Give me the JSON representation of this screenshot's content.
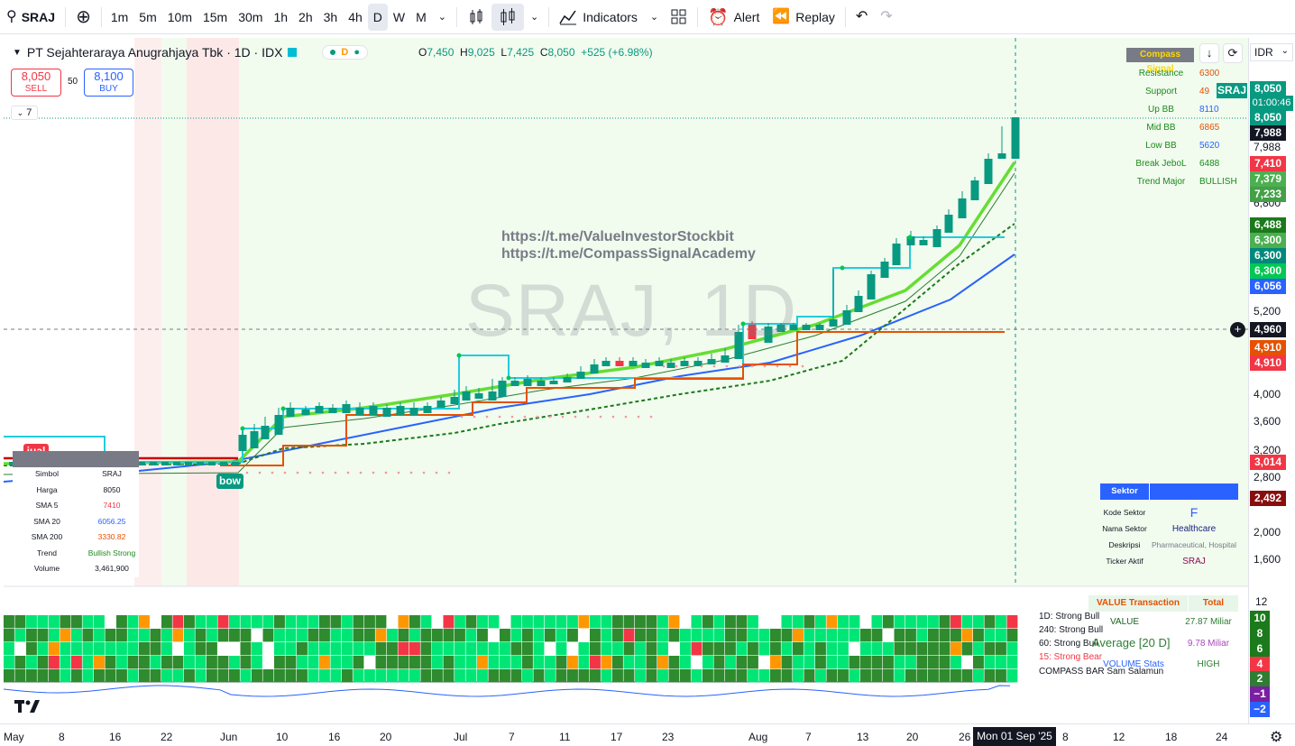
{
  "toolbar": {
    "symbol": "SRAJ",
    "intervals": [
      "1m",
      "5m",
      "10m",
      "15m",
      "30m",
      "1h",
      "2h",
      "3h",
      "4h",
      "D",
      "W",
      "M"
    ],
    "active_interval": "D",
    "indicators_label": "Indicators",
    "alert_label": "Alert",
    "replay_label": "Replay"
  },
  "legend": {
    "title": "PT Sejahteraraya Anugrahjaya Tbk · 1D · IDX",
    "badge": "D",
    "o_label": "O",
    "o": "7,450",
    "h_label": "H",
    "h": "9,025",
    "l_label": "L",
    "l": "7,425",
    "c_label": "C",
    "c": "8,050",
    "change": "+525 (+6.98%)",
    "sell_price": "8,050",
    "sell_label": "SELL",
    "buy_price": "8,100",
    "buy_label": "BUY",
    "spread": "50",
    "collapse_count": "7"
  },
  "watermark": "SRAJ, 1D",
  "links": [
    "https://t.me/ValueInvestorStockbit",
    "https://t.me/CompassSignalAcademy"
  ],
  "compass_signal": {
    "header": "Compass Signal",
    "rows": [
      {
        "label": "Resistance",
        "value": "6300",
        "color": "#e65100"
      },
      {
        "label": "Support",
        "value": "49",
        "color": "#e65100"
      },
      {
        "label": "Up BB",
        "value": "8110",
        "color": "#2962ff"
      },
      {
        "label": "Mid BB",
        "value": "6865",
        "color": "#e65100"
      },
      {
        "label": "Low BB",
        "value": "5620",
        "color": "#2962ff"
      },
      {
        "label": "Break JeboL",
        "value": "6488",
        "color": "#1b8a1b"
      },
      {
        "label": "Trend Major",
        "value": "BULLISH",
        "color": "#1b8a1b"
      }
    ]
  },
  "scale": {
    "currency": "IDR",
    "ticks": [
      "7,988",
      "6,800",
      "5,200",
      "4,000",
      "3,600",
      "3,200",
      "2,800",
      "2,000",
      "1,600"
    ],
    "badges": [
      {
        "text": "SRAJ",
        "color": "#089981"
      },
      {
        "text": "8,050",
        "color": "#089981"
      },
      {
        "text": "01:00:46",
        "color": "#089981"
      },
      {
        "text": "8,050",
        "color": "#089981"
      },
      {
        "text": "7,988",
        "color": "#131722"
      },
      {
        "text": "7,410",
        "color": "#f23645"
      },
      {
        "text": "7,379",
        "color": "#4caf50"
      },
      {
        "text": "7,233",
        "color": "#43a047"
      },
      {
        "text": "6,488",
        "color": "#1b7a1b"
      },
      {
        "text": "6,300",
        "color": "#4caf50"
      },
      {
        "text": "6,300",
        "color": "#00897b"
      },
      {
        "text": "6,300",
        "color": "#00c853"
      },
      {
        "text": "6,056",
        "color": "#2962ff"
      },
      {
        "text": "4,960",
        "color": "#131722"
      },
      {
        "text": "4,910",
        "color": "#e65100"
      },
      {
        "text": "4,910",
        "color": "#f23645"
      },
      {
        "text": "3,014",
        "color": "#f23645"
      },
      {
        "text": "2,492",
        "color": "#880e0e"
      }
    ],
    "lower_ticks": [
      "12",
      "10",
      "8",
      "6",
      "4",
      "2",
      "−1",
      "−2"
    ]
  },
  "markers": {
    "jual": "jual",
    "bow": "bow"
  },
  "info_table": {
    "rows": [
      {
        "k": "Simbol",
        "v": "SRAJ",
        "color": "#131722"
      },
      {
        "k": "Harga",
        "v": "8050",
        "color": "#131722"
      },
      {
        "k": "SMA 5",
        "v": "7410",
        "color": "#f23645"
      },
      {
        "k": "SMA 20",
        "v": "6056.25",
        "color": "#2962ff"
      },
      {
        "k": "SMA 200",
        "v": "3330.82",
        "color": "#e65100"
      },
      {
        "k": "Trend",
        "v": "Bullish Strong",
        "color": "#1b8a1b"
      },
      {
        "k": "Volume",
        "v": "3,461,900",
        "color": "#131722"
      }
    ]
  },
  "sektor": {
    "header": "Sektor",
    "rows": [
      {
        "k": "Kode Sektor",
        "v": "F",
        "color": "#2962ff"
      },
      {
        "k": "Nama Sektor",
        "v": "Healthcare",
        "color": "#1a237e"
      },
      {
        "k": "Deskripsi",
        "v": "Pharmaceutical, Hospital",
        "color": "#787b86"
      },
      {
        "k": "Ticker Aktif",
        "v": "SRAJ",
        "color": "#880e4f"
      }
    ]
  },
  "heatmap_labels": [
    {
      "text": "1D: Strong Bull",
      "color": "#131722"
    },
    {
      "text": "240: Strong Bull",
      "color": "#131722"
    },
    {
      "text": "60: Strong Bull",
      "color": "#131722"
    },
    {
      "text": "15: Strong Bear",
      "color": "#f23645"
    },
    {
      "text": "COMPASS BAR Sam Salamun",
      "color": "#131722"
    }
  ],
  "value_table": {
    "h1": "VALUE Transaction",
    "h2": "Total",
    "r1k": "VALUE",
    "r1v": "27.87 Miliar",
    "r2k": "Average [20 D]",
    "r2v": "9.78 Miliar",
    "r3k": "VOLUME Stats",
    "r3v": "HIGH"
  },
  "time_axis": {
    "labels": [
      "May",
      "8",
      "16",
      "22",
      "Jun",
      "10",
      "16",
      "20",
      "Jul",
      "7",
      "11",
      "17",
      "23",
      "Aug",
      "7",
      "13",
      "20",
      "26",
      "8",
      "12",
      "18",
      "24"
    ],
    "current": "Mon 01 Sep '25"
  }
}
